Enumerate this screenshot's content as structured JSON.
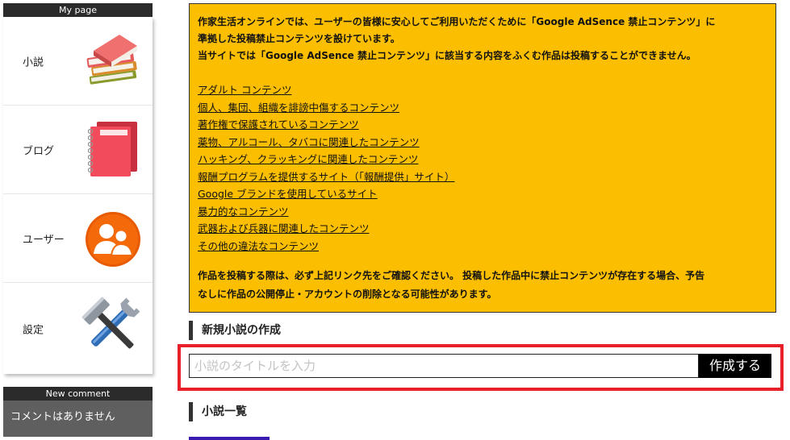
{
  "sidebar": {
    "mypage_title": "My page",
    "items": [
      {
        "label": "小説",
        "icon": "books-icon"
      },
      {
        "label": "ブログ",
        "icon": "notebooks-icon"
      },
      {
        "label": "ユーザー",
        "icon": "users-icon"
      },
      {
        "label": "設定",
        "icon": "wrench-hammer-icon"
      }
    ],
    "new_comment_title": "New comment",
    "comment_text": "コメントはありません"
  },
  "notice": {
    "intro_line1": "作家生活オンラインでは、ユーザーの皆様に安心してご利用いただくために「Google AdSence 禁止コンテンツ」に",
    "intro_line2": "準拠した投稿禁止コンテンツを設けています。",
    "intro_line3": "当サイトでは「Google AdSence 禁止コンテンツ」に該当する内容をふくむ作品は投稿することができません。",
    "links": [
      "アダルト コンテンツ",
      "個人、集団、組織を誹謗中傷するコンテンツ",
      "著作権で保護されているコンテンツ",
      "薬物、アルコール、タバコに関連したコンテンツ",
      "ハッキング、クラッキングに関連したコンテンツ",
      "報酬プログラムを提供するサイト（「報酬提供」サイト）",
      "Google ブランドを使用しているサイト",
      "暴力的なコンテンツ",
      "武器および兵器に関連したコンテンツ",
      "その他の違法なコンテンツ"
    ],
    "footer_line1": "作品を投稿する際は、必ず上記リンク先をご確認ください。 投稿した作品中に禁止コンテンツが存在する場合、予告",
    "footer_line2": "なしに作品の公開停止・アカウントの削除となる可能性があります。"
  },
  "create": {
    "section_title": "新規小説の作成",
    "title_placeholder": "小説のタイトルを入力",
    "title_value": "",
    "button_label": "作成する"
  },
  "list": {
    "section_title": "小説一覧"
  },
  "colors": {
    "notice_bg": "#fcbe00",
    "highlight_border": "#e8202a",
    "sidebar_header": "#2b2b2b"
  }
}
